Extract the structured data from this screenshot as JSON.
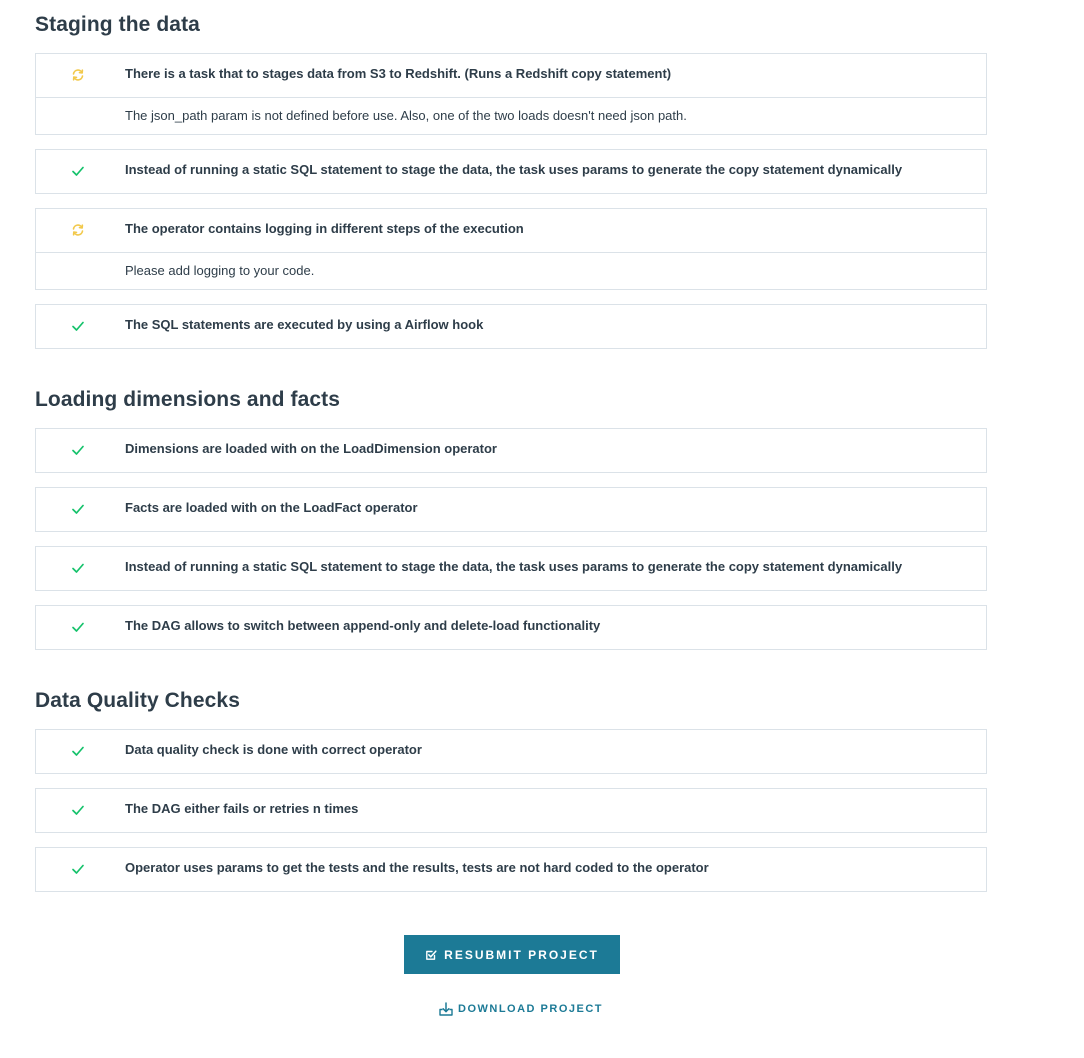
{
  "colors": {
    "pass": "#15c26b",
    "needs_revision": "#f2c94c",
    "accent": "#1c7a96",
    "text": "#2e3d49",
    "border": "#dbe2e8"
  },
  "sections": [
    {
      "title": "Staging the data",
      "criteria": [
        {
          "status_icon": "refresh-icon",
          "text": "There is a task that to stages data from S3 to Redshift. (Runs a Redshift copy statement)",
          "comment": "The json_path param is not defined before use. Also, one of the two loads doesn't need json path."
        },
        {
          "status_icon": "check-icon",
          "text": "Instead of running a static SQL statement to stage the data, the task uses params to generate the copy statement dynamically"
        },
        {
          "status_icon": "refresh-icon",
          "text": "The operator contains logging in different steps of the execution",
          "comment": "Please add logging to your code."
        },
        {
          "status_icon": "check-icon",
          "text": "The SQL statements are executed by using a Airflow hook"
        }
      ]
    },
    {
      "title": "Loading dimensions and facts",
      "criteria": [
        {
          "status_icon": "check-icon",
          "text": "Dimensions are loaded with on the LoadDimension operator"
        },
        {
          "status_icon": "check-icon",
          "text": "Facts are loaded with on the LoadFact operator"
        },
        {
          "status_icon": "check-icon",
          "text": "Instead of running a static SQL statement to stage the data, the task uses params to generate the copy statement dynamically"
        },
        {
          "status_icon": "check-icon",
          "text": "The DAG allows to switch between append-only and delete-load functionality"
        }
      ]
    },
    {
      "title": "Data Quality Checks",
      "criteria": [
        {
          "status_icon": "check-icon",
          "text": "Data quality check is done with correct operator"
        },
        {
          "status_icon": "check-icon",
          "text": "The DAG either fails or retries n times"
        },
        {
          "status_icon": "check-icon",
          "text": "Operator uses params to get the tests and the results, tests are not hard coded to the operator"
        }
      ]
    }
  ],
  "actions": {
    "resubmit_label": "RESUBMIT PROJECT",
    "resubmit_icon": "checkbox-edit-icon",
    "download_label": "DOWNLOAD PROJECT",
    "download_icon": "download-icon"
  }
}
